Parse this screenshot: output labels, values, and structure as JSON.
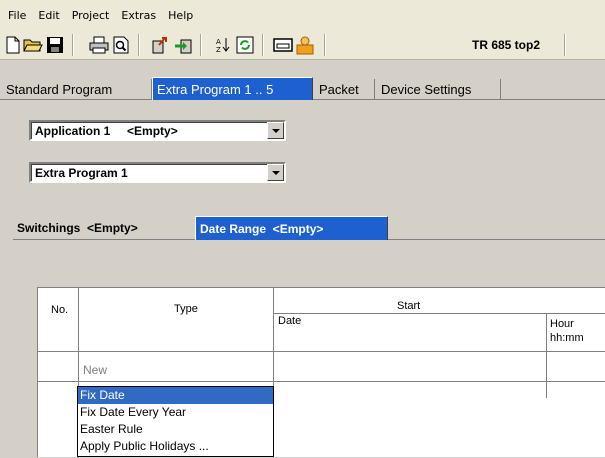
{
  "menu": [
    "File",
    "Edit",
    "Project",
    "Extras",
    "Help"
  ],
  "toolbar": {
    "icons": [
      "new-file-icon",
      "open-folder-icon",
      "save-icon",
      "print-icon",
      "print-preview-icon",
      "upload-icon",
      "download-icon",
      "sort-icon",
      "refresh-icon",
      "window-icon",
      "user-icon"
    ],
    "device_title": "TR 685 top2"
  },
  "main_tabs": [
    {
      "label": "Standard Program",
      "active": false
    },
    {
      "label": "Extra Program 1 .. 5",
      "active": true
    },
    {
      "label": "Packet",
      "active": false
    },
    {
      "label": "Device Settings",
      "active": false
    }
  ],
  "application_combo": {
    "value": "Application 1     <Empty>"
  },
  "program_combo": {
    "value": "Extra Program 1"
  },
  "sub_tabs": [
    {
      "label": "Switchings  <Empty>",
      "active": false
    },
    {
      "label": "Date Range  <Empty>",
      "active": true
    }
  ],
  "table": {
    "col_no": "No.",
    "col_type": "Type",
    "col_start": "Start",
    "col_date": "Date",
    "col_hour": "Hour",
    "col_hour_fmt": "hh:mm",
    "new_row": "New"
  },
  "type_dropdown": {
    "options": [
      "Fix Date",
      "Fix Date Every Year",
      "Easter Rule",
      "Apply Public Holidays ..."
    ],
    "selected": "Fix Date"
  },
  "colors": {
    "accent": "#1f60d0",
    "selection": "#316ac5",
    "background": "#d4d0c8"
  }
}
